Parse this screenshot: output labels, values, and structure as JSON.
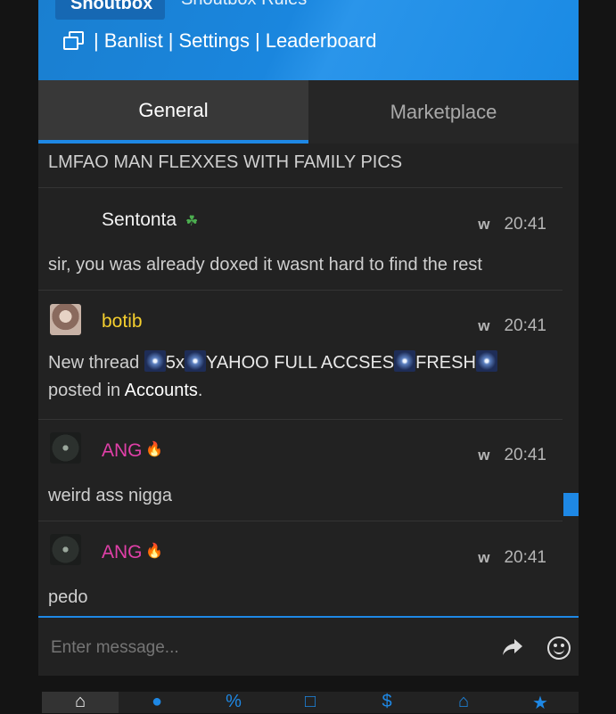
{
  "header": {
    "shoutbox_tab": "Shoutbox",
    "rules_link": "Shoutbox Rules",
    "links": [
      "Banlist",
      "Settings",
      "Leaderboard"
    ],
    "separator": "|"
  },
  "tabs": [
    {
      "label": "General",
      "active": true
    },
    {
      "label": "Marketplace",
      "active": false
    }
  ],
  "messages": {
    "top_partial": "LMFAO MAN FLEXXES WITH FAMILY PICS",
    "items": [
      {
        "user": "Sentonta",
        "badge_icon": "leaf-icon",
        "status": "w",
        "time": "20:41",
        "text": "sir, you was already doxed it wasnt hard to find the rest"
      },
      {
        "user": "botib",
        "status": "w",
        "time": "20:41",
        "thread_prefix": "New thread",
        "thread_parts": [
          "5x",
          "YAHOO FULL ACCSES",
          "FRESH"
        ],
        "posted_in": "posted in",
        "forum": "Accounts",
        "period": "."
      },
      {
        "user": "ANG",
        "badge_icon": "fire-icon",
        "status": "w",
        "time": "20:41",
        "text": "weird ass nigga"
      },
      {
        "user": "ANG",
        "badge_icon": "fire-icon",
        "status": "w",
        "time": "20:41",
        "text": "pedo"
      }
    ]
  },
  "input": {
    "placeholder": "Enter message..."
  },
  "icons": {
    "share": "share-icon",
    "emoji": "smile-icon"
  },
  "colors": {
    "accent": "#1e88e5",
    "username_gold": "#f5cf2e",
    "username_pink": "#e040a8"
  }
}
